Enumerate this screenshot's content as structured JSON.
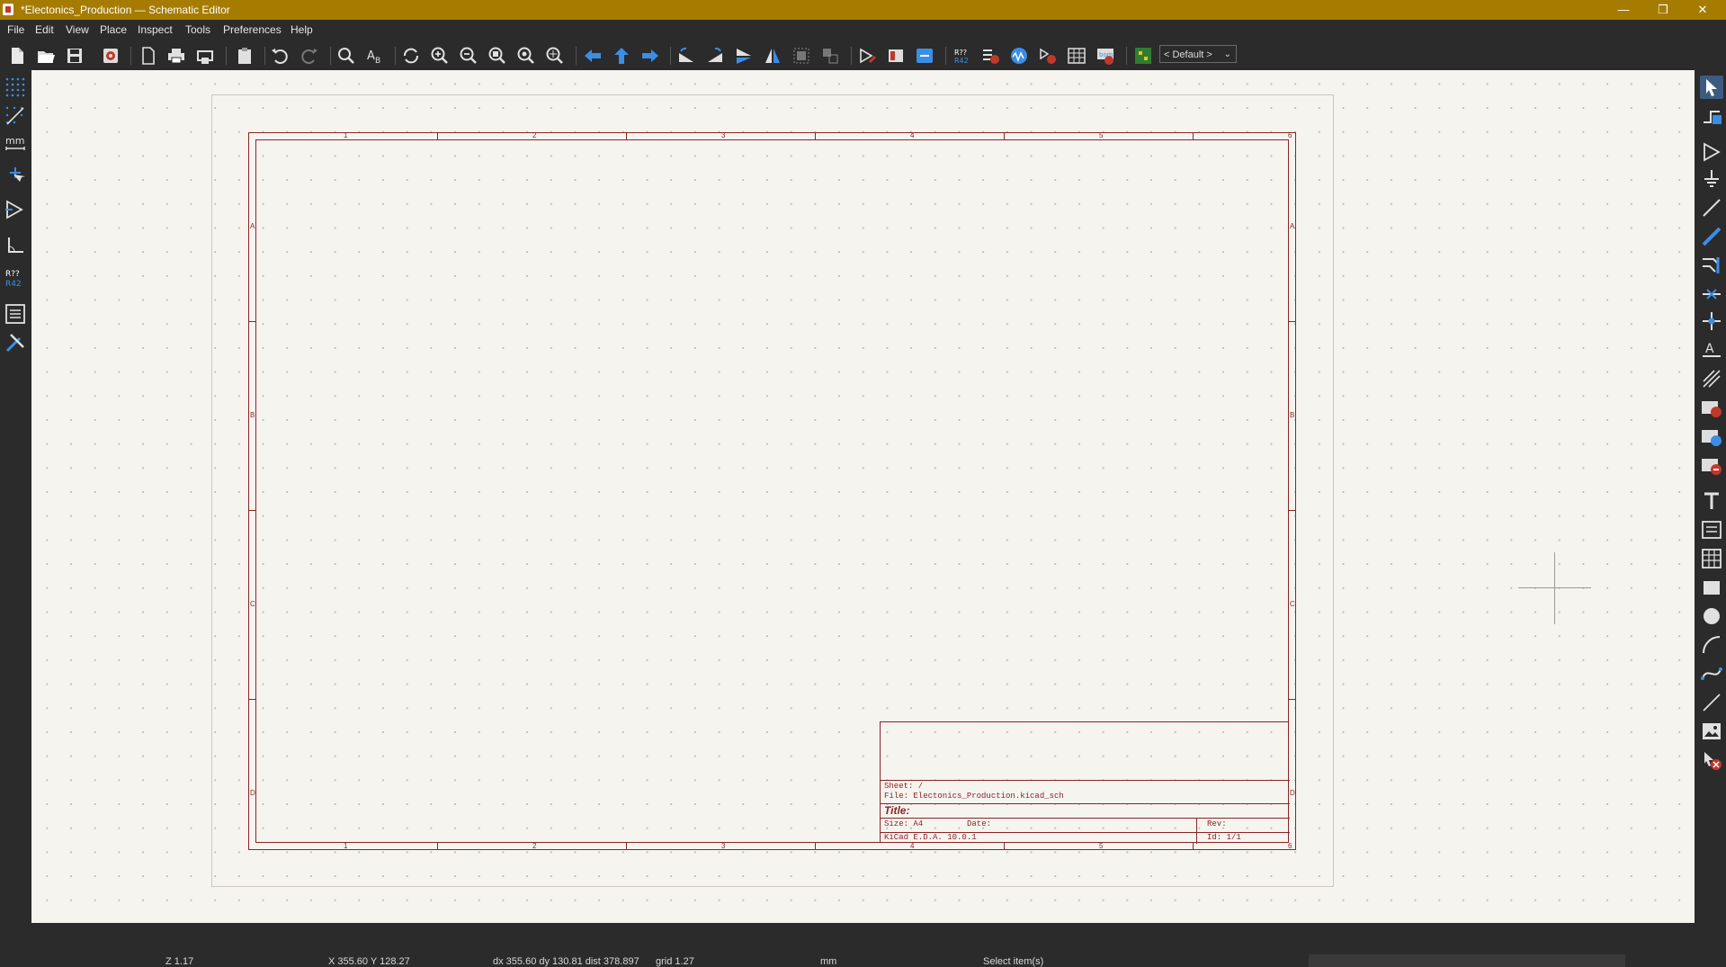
{
  "window": {
    "title": "*Electonics_Production — Schematic Editor",
    "minimize": "—",
    "maximize": "❐",
    "close": "✕"
  },
  "menu": [
    "File",
    "Edit",
    "View",
    "Place",
    "Inspect",
    "Tools",
    "Preferences",
    "Help"
  ],
  "toolbar": {
    "icons": [
      "new-schematic-icon",
      "open-icon",
      "save-icon",
      "schematic-setup-icon",
      "page-settings-icon",
      "print-icon",
      "plot-icon",
      "paste-icon",
      "undo-icon",
      "redo-icon",
      "find-icon",
      "find-replace-icon",
      "refresh-icon",
      "zoom-in-icon",
      "zoom-out-icon",
      "zoom-fit-icon",
      "zoom-objects-icon",
      "zoom-selection-icon",
      "navigate-back-icon",
      "navigate-up-icon",
      "navigate-forward-icon",
      "rotate-ccw-icon",
      "rotate-cw-icon",
      "mirror-vertical-icon",
      "mirror-horizontal-icon",
      "group-icon",
      "ungroup-icon",
      "symbol-editor-icon",
      "symbol-browser-icon",
      "footprint-assign-icon",
      "annotate-icon",
      "erc-icon",
      "simulator-icon",
      "assign-footprints-icon",
      "field-table-icon",
      "bom-icon",
      "pcb-editor-icon"
    ],
    "variant_dropdown": "< Default >"
  },
  "left_toolbar": [
    "grid-dots-icon",
    "grid-overrides-icon",
    "units-mm-icon",
    "cursor-full-icon",
    "hierarchy-icon",
    "line-angle-icon",
    "annotate-r42-icon",
    "properties-panel-icon",
    "tools-icon"
  ],
  "left_units_label": "mm",
  "right_toolbar": [
    "select-icon",
    "highlight-net-icon",
    "add-symbol-icon",
    "add-power-icon",
    "add-wire-icon",
    "add-bus-icon",
    "bus-entry-icon",
    "no-connect-icon",
    "junction-icon",
    "net-label-icon",
    "directive-label-icon",
    "global-label-icon",
    "hier-label-icon",
    "sheet-pin-icon",
    "text-icon",
    "textbox-icon",
    "table-icon",
    "rectangle-icon",
    "circle-icon",
    "arc-icon",
    "bezier-icon",
    "line-icon",
    "image-icon",
    "delete-icon"
  ],
  "sheet": {
    "columns": [
      "1",
      "2",
      "3",
      "4",
      "5",
      "6"
    ],
    "rows": [
      "A",
      "B",
      "C",
      "D"
    ],
    "title_block": {
      "sheet": "Sheet: /",
      "file": "File: Electonics_Production.kicad_sch",
      "title": "Title:",
      "size": "Size: A4",
      "date": "Date:",
      "rev": "Rev:",
      "kicad": "KiCad E.D.A. 10.0.1",
      "id": "Id: 1/1"
    }
  },
  "status": {
    "zoom": "Z 1.17",
    "xy": "X 355.60  Y 128.27",
    "delta": "dx 355.60  dy 130.81  dist 378.897",
    "grid": "grid 1.27",
    "units": "mm",
    "message": "Select item(s)"
  },
  "colors": {
    "title_bar": "#a67c00",
    "sheet_frame": "#8a2528",
    "canvas": "#f5f4ef"
  }
}
